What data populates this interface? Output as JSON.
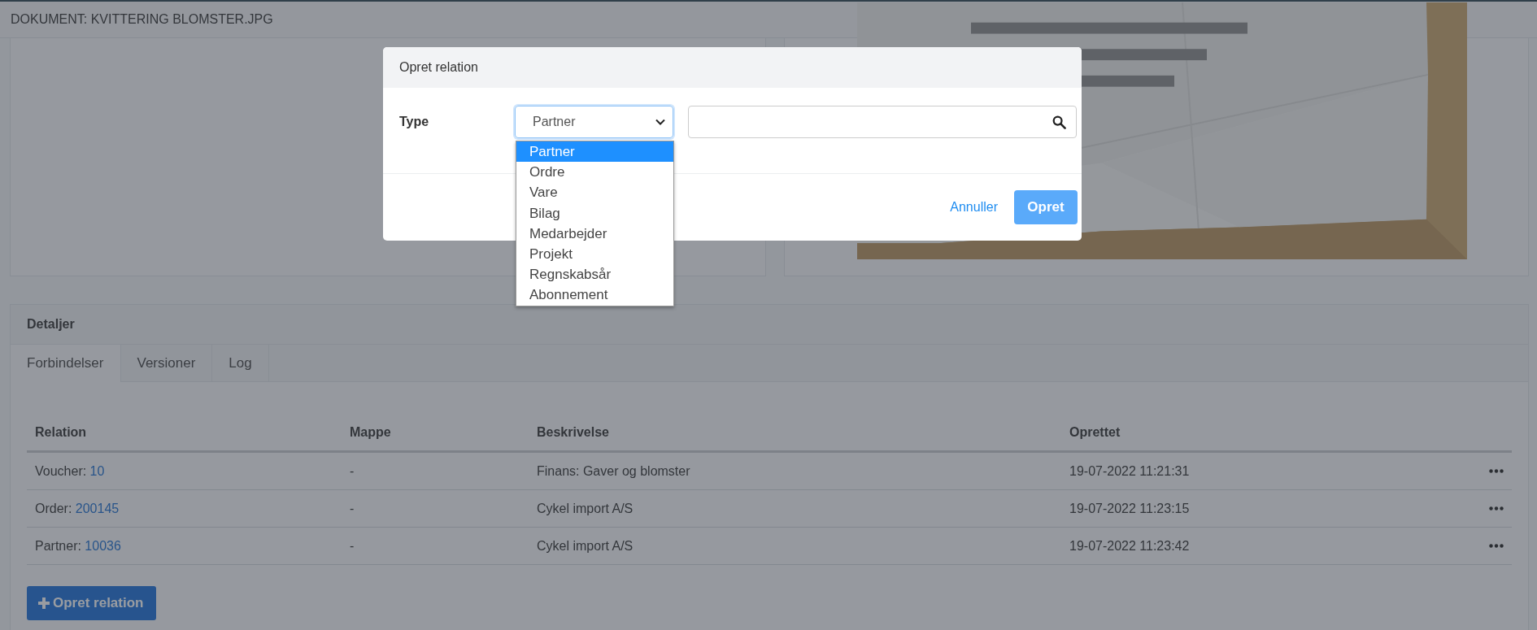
{
  "document": {
    "title": "DOKUMENT: KVITTERING BLOMSTER.JPG"
  },
  "details": {
    "title": "Detaljer",
    "tabs": [
      {
        "label": "Forbindelser",
        "selected": true
      },
      {
        "label": "Versioner",
        "selected": false
      },
      {
        "label": "Log",
        "selected": false
      }
    ],
    "table": {
      "columns": [
        "Relation",
        "Mappe",
        "Beskrivelse",
        "Oprettet"
      ],
      "rows": [
        {
          "relation_type": "Voucher:",
          "relation_link": "10",
          "mappe": "-",
          "beskrivelse": "Finans: Gaver og blomster",
          "oprettet": "19-07-2022 11:21:31"
        },
        {
          "relation_type": "Order:",
          "relation_link": "200145",
          "mappe": "-",
          "beskrivelse": "Cykel import A/S",
          "oprettet": "19-07-2022 11:23:15"
        },
        {
          "relation_type": "Partner:",
          "relation_link": "10036",
          "mappe": "-",
          "beskrivelse": "Cykel import A/S",
          "oprettet": "19-07-2022 11:23:42"
        }
      ]
    },
    "add_button": "Opret relation"
  },
  "modal": {
    "title": "Opret relation",
    "type_label": "Type",
    "type_select": {
      "value": "Partner",
      "expanded": true,
      "options": [
        {
          "label": "Partner",
          "selected": true
        },
        {
          "label": "Ordre",
          "selected": false
        },
        {
          "label": "Vare",
          "selected": false
        },
        {
          "label": "Bilag",
          "selected": false
        },
        {
          "label": "Medarbejder",
          "selected": false
        },
        {
          "label": "Projekt",
          "selected": false
        },
        {
          "label": "Regnskabsår",
          "selected": false
        },
        {
          "label": "Abonnement",
          "selected": false
        }
      ]
    },
    "cancel_button": "Annuller",
    "create_button": "Opret"
  }
}
